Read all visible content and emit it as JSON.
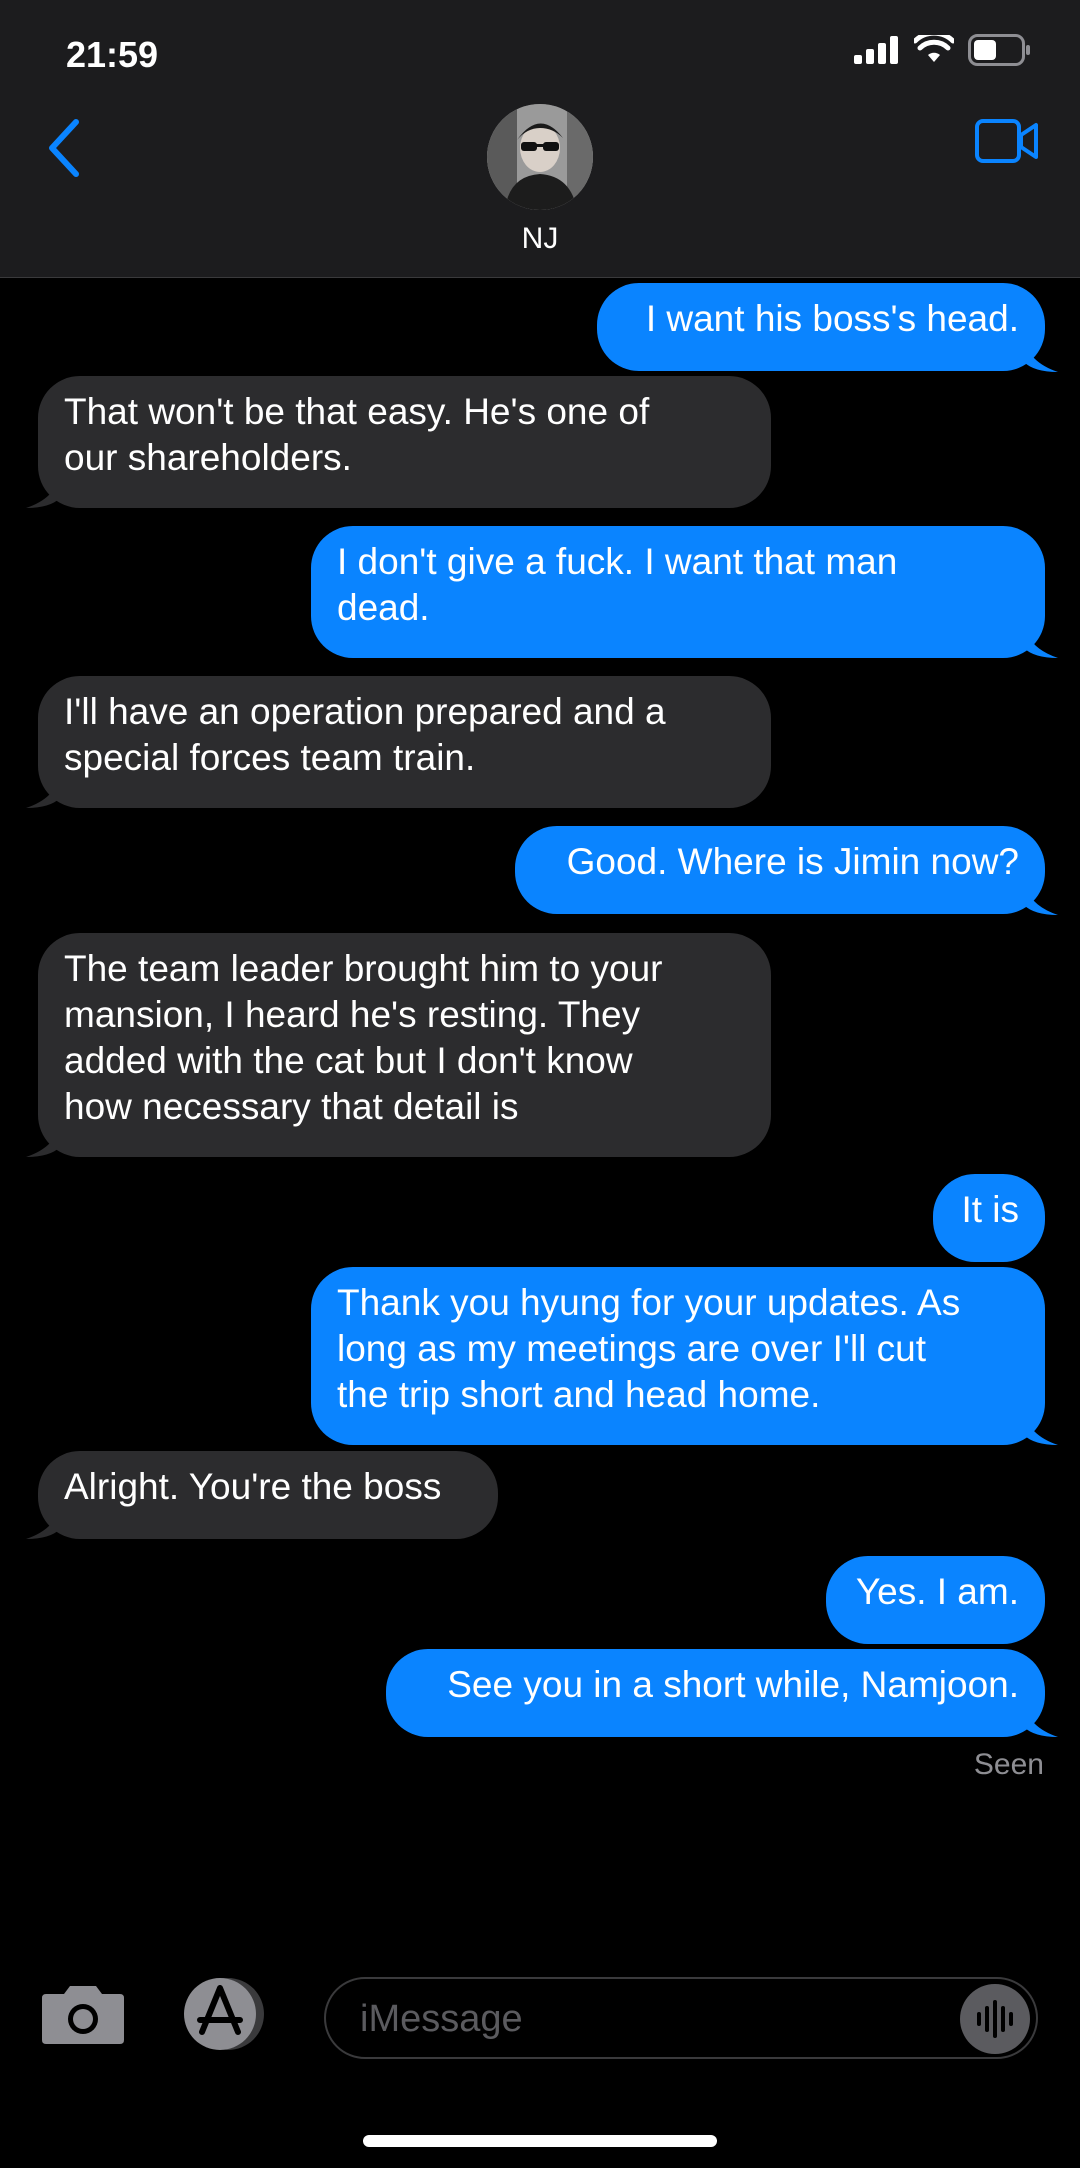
{
  "status_bar": {
    "time": "21:59"
  },
  "contact": {
    "name": "NJ"
  },
  "icons": {
    "back": "chevron-left-icon",
    "video": "video-camera-icon",
    "camera": "camera-icon",
    "apps": "app-store-icon",
    "audio": "audio-waveform-icon"
  },
  "colors": {
    "accent": "#0a84ff",
    "received": "#2c2c2e",
    "header": "#1c1c1e"
  },
  "messages": [
    {
      "dir": "out",
      "text": "I want his boss's head."
    },
    {
      "dir": "in",
      "line1": "That won't be that easy. He's one of",
      "line2": "our shareholders."
    },
    {
      "dir": "out",
      "line1": "I don't give a fuck. I want that man",
      "line2": "dead."
    },
    {
      "dir": "in",
      "line1": "I'll have an operation prepared and a",
      "line2": "special forces team train."
    },
    {
      "dir": "out",
      "text": "Good. Where is Jimin now?"
    },
    {
      "dir": "in",
      "line1": "The team leader brought him to your",
      "line2": "mansion, I heard he's resting. They",
      "line3": "added with the cat but I don't know",
      "line4": "how necessary that detail is"
    },
    {
      "dir": "out",
      "text": "It is"
    },
    {
      "dir": "out",
      "line1": "Thank you hyung for your updates. As",
      "line2": "long as my meetings are over I'll cut",
      "line3": "the trip short and head home."
    },
    {
      "dir": "in",
      "text": "Alright. You're the boss"
    },
    {
      "dir": "out",
      "text": "Yes. I am."
    },
    {
      "dir": "out",
      "text": "See you in a short while, Namjoon."
    }
  ],
  "receipt": "Seen",
  "composer": {
    "placeholder": "iMessage"
  }
}
